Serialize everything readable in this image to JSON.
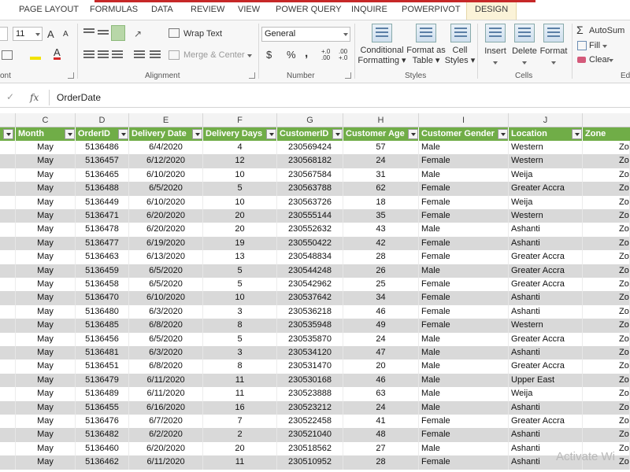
{
  "ribbon_tabs": [
    "PAGE LAYOUT",
    "FORMULAS",
    "DATA",
    "REVIEW",
    "VIEW",
    "POWER QUERY",
    "INQUIRE",
    "POWERPIVOT",
    "DESIGN"
  ],
  "font": {
    "size": "11",
    "grow": "A",
    "shrink": "A",
    "color_letter": "A",
    "group_label": "ont"
  },
  "alignment": {
    "wrap_text": "Wrap Text",
    "merge_center": "Merge & Center",
    "group_label": "Alignment"
  },
  "number": {
    "format": "General",
    "currency": "$",
    "percent": "%",
    "comma": ",",
    "inc_decimal": "+.0 .00",
    "dec_decimal": ".00 +.0",
    "group_label": "Number"
  },
  "styles": {
    "conditional": "Conditional",
    "formatting": "Formatting",
    "format_as": "Format as",
    "table": "Table",
    "cell": "Cell",
    "cell_styles": "Styles",
    "group_label": "Styles"
  },
  "cells": {
    "insert": "Insert",
    "delete": "Delete",
    "format": "Format",
    "group_label": "Cells"
  },
  "editing": {
    "autosum": "AutoSum",
    "fill": "Fill",
    "clear": "Clear",
    "group_label": "Ed"
  },
  "formula_bar": {
    "fx": "fx",
    "check": "✓",
    "value": "OrderDate"
  },
  "columns": [
    "C",
    "D",
    "E",
    "F",
    "G",
    "H",
    "I",
    "J"
  ],
  "headers": [
    "Month",
    "OrderID",
    "Delivery Date",
    "Delivery Days",
    "CustomerID",
    "Customer Age",
    "Customer Gender",
    "Location",
    "Zone"
  ],
  "rows": [
    [
      "May",
      "5136486",
      "6/4/2020",
      "4",
      "230569424",
      "57",
      "Male",
      "Western",
      "Zo"
    ],
    [
      "May",
      "5136457",
      "6/12/2020",
      "12",
      "230568182",
      "24",
      "Female",
      "Western",
      "Zo"
    ],
    [
      "May",
      "5136465",
      "6/10/2020",
      "10",
      "230567584",
      "31",
      "Male",
      "Weija",
      "Zo"
    ],
    [
      "May",
      "5136488",
      "6/5/2020",
      "5",
      "230563788",
      "62",
      "Female",
      "Greater Accra",
      "Zo"
    ],
    [
      "May",
      "5136449",
      "6/10/2020",
      "10",
      "230563726",
      "18",
      "Female",
      "Weija",
      "Zo"
    ],
    [
      "May",
      "5136471",
      "6/20/2020",
      "20",
      "230555144",
      "35",
      "Female",
      "Western",
      "Zo"
    ],
    [
      "May",
      "5136478",
      "6/20/2020",
      "20",
      "230552632",
      "43",
      "Male",
      "Ashanti",
      "Zo"
    ],
    [
      "May",
      "5136477",
      "6/19/2020",
      "19",
      "230550422",
      "42",
      "Female",
      "Ashanti",
      "Zo"
    ],
    [
      "May",
      "5136463",
      "6/13/2020",
      "13",
      "230548834",
      "28",
      "Female",
      "Greater Accra",
      "Zo"
    ],
    [
      "May",
      "5136459",
      "6/5/2020",
      "5",
      "230544248",
      "26",
      "Male",
      "Greater Accra",
      "Zo"
    ],
    [
      "May",
      "5136458",
      "6/5/2020",
      "5",
      "230542962",
      "25",
      "Female",
      "Greater Accra",
      "Zo"
    ],
    [
      "May",
      "5136470",
      "6/10/2020",
      "10",
      "230537642",
      "34",
      "Female",
      "Ashanti",
      "Zo"
    ],
    [
      "May",
      "5136480",
      "6/3/2020",
      "3",
      "230536218",
      "46",
      "Female",
      "Ashanti",
      "Zo"
    ],
    [
      "May",
      "5136485",
      "6/8/2020",
      "8",
      "230535948",
      "49",
      "Female",
      "Western",
      "Zo"
    ],
    [
      "May",
      "5136456",
      "6/5/2020",
      "5",
      "230535870",
      "24",
      "Male",
      "Greater Accra",
      "Zo"
    ],
    [
      "May",
      "5136481",
      "6/3/2020",
      "3",
      "230534120",
      "47",
      "Male",
      "Ashanti",
      "Zo"
    ],
    [
      "May",
      "5136451",
      "6/8/2020",
      "8",
      "230531470",
      "20",
      "Male",
      "Greater Accra",
      "Zo"
    ],
    [
      "May",
      "5136479",
      "6/11/2020",
      "11",
      "230530168",
      "46",
      "Male",
      "Upper East",
      "Zo"
    ],
    [
      "May",
      "5136489",
      "6/11/2020",
      "11",
      "230523888",
      "63",
      "Male",
      "Weija",
      "Zo"
    ],
    [
      "May",
      "5136455",
      "6/16/2020",
      "16",
      "230523212",
      "24",
      "Male",
      "Ashanti",
      "Zo"
    ],
    [
      "May",
      "5136476",
      "6/7/2020",
      "7",
      "230522458",
      "41",
      "Female",
      "Greater Accra",
      "Zo"
    ],
    [
      "May",
      "5136482",
      "6/2/2020",
      "2",
      "230521040",
      "48",
      "Female",
      "Ashanti",
      "Zo"
    ],
    [
      "May",
      "5136460",
      "6/20/2020",
      "20",
      "230518562",
      "27",
      "Male",
      "Ashanti",
      "Zo"
    ],
    [
      "May",
      "5136462",
      "6/11/2020",
      "11",
      "230510952",
      "28",
      "Female",
      "Ashanti",
      "Zo"
    ]
  ],
  "watermark": "Activate Wi",
  "colors": {
    "header_green": "#70ad47",
    "alt_row": "#d9d9d9",
    "design_tab": "#fbf3d8",
    "accent_red": "#c62828"
  }
}
